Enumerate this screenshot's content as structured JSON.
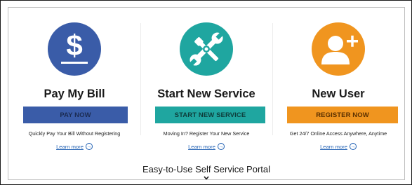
{
  "columns": [
    {
      "title": "Pay My Bill",
      "button_label": "PAY NOW",
      "description": "Quickly Pay Your Bill Without Registering",
      "link_label": "Learn more",
      "icon": "dollar-sign-icon",
      "color": "#3a5ca8",
      "button_text_color": "#1b2b52"
    },
    {
      "title": "Start New Service",
      "button_label": "START NEW SERVICE",
      "description": "Moving In? Register Your New Service",
      "link_label": "Learn more",
      "icon": "wrench-screwdriver-icon",
      "color": "#1fa6a0",
      "button_text_color": "#0e3d3b"
    },
    {
      "title": "New User",
      "button_label": "REGISTER NOW",
      "description": "Get 24/7 Online Access Anywhere, Anytime",
      "link_label": "Learn more",
      "icon": "add-user-icon",
      "color": "#f0951f",
      "button_text_color": "#5a3000"
    }
  ],
  "portal": {
    "title": "Easy-to-Use Self Service Portal",
    "expand_icon": "chevron-down-icon"
  }
}
